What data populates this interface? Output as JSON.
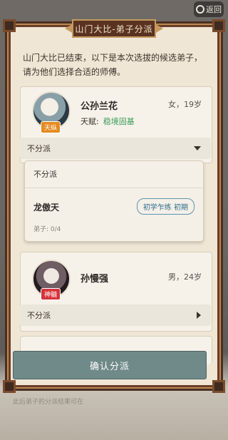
{
  "header": {
    "back_label": "返回"
  },
  "panel": {
    "title": "山门大比-弟子分派",
    "description": "山门大比已结束，以下是本次选拔的候选弟子，请为他们选择合适的师傅。"
  },
  "candidates": [
    {
      "name": "公孙兰花",
      "meta": "女，19岁",
      "badge": "天纵",
      "talent_label": "天赋:",
      "talent_value": "稳境固基",
      "assignment": "不分派",
      "dropdown_open": true
    },
    {
      "name": "孙慢强",
      "meta": "男，24岁",
      "badge": "神髓",
      "assignment": "不分派",
      "dropdown_open": false
    }
  ],
  "dropdown_menu": {
    "none_option": "不分派",
    "masters": [
      {
        "name": "龙傲天",
        "rank": "初学乍练 初期",
        "disciples": "弟子: 0/4"
      }
    ]
  },
  "confirm_label": "确认分派",
  "footer_faded": "此后弟子的分派结果可在"
}
